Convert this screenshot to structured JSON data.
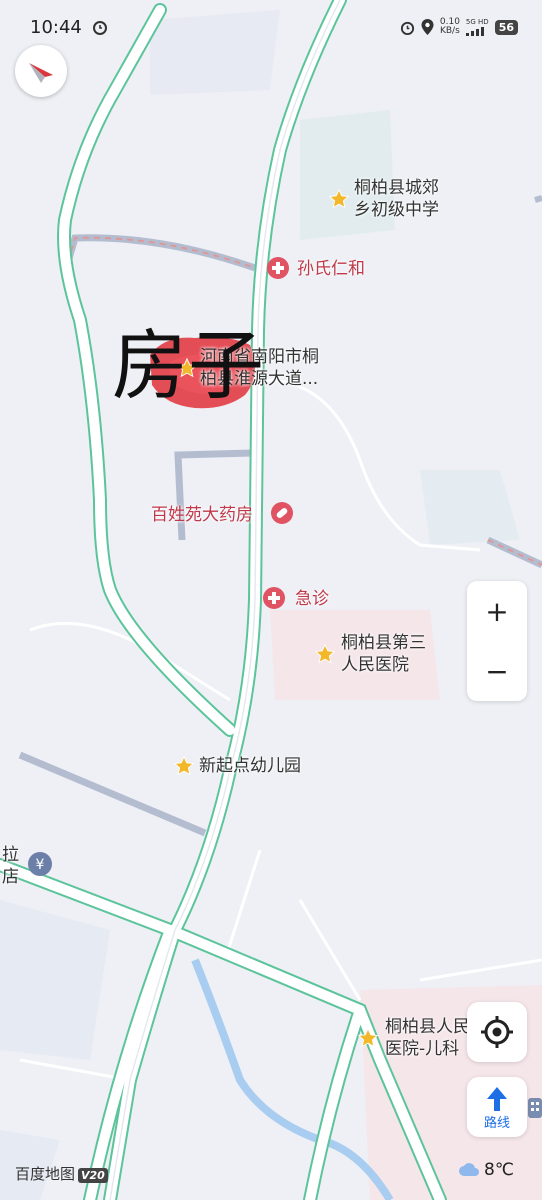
{
  "status_bar": {
    "time": "10:44",
    "net_speed": "0.10",
    "net_unit": "KB/s",
    "signal_label": "5G HD",
    "battery": "56"
  },
  "map": {
    "pois": [
      {
        "id": "school",
        "lines": [
          "桐柏县城郊",
          "乡初级中学"
        ],
        "color": "dark"
      },
      {
        "id": "sunshi",
        "lines": [
          "孙氏仁和"
        ],
        "color": "red"
      },
      {
        "id": "address",
        "lines": [
          "河南省南阳市桐",
          "柏县淮源大道..."
        ],
        "color": "dark"
      },
      {
        "id": "pharmacy",
        "lines": [
          "百姓苑大药房"
        ],
        "color": "red"
      },
      {
        "id": "emergency",
        "lines": [
          "急诊"
        ],
        "color": "red"
      },
      {
        "id": "hospital3",
        "lines": [
          "桐柏县第三",
          "人民医院"
        ],
        "color": "dark"
      },
      {
        "id": "kindergarten",
        "lines": [
          "新起点幼儿园"
        ],
        "color": "dark"
      },
      {
        "id": "atm",
        "lines": [
          "拉",
          "店"
        ],
        "color": "dark"
      },
      {
        "id": "pediatrics",
        "lines": [
          "桐柏县人民",
          "医院-儿科"
        ],
        "color": "dark"
      }
    ]
  },
  "annotation": "房子",
  "controls": {
    "zoom_in": "+",
    "zoom_out": "−",
    "route_label": "路线"
  },
  "footer": {
    "logo_text": "百度地图",
    "version": "V20",
    "temperature": "8℃"
  }
}
